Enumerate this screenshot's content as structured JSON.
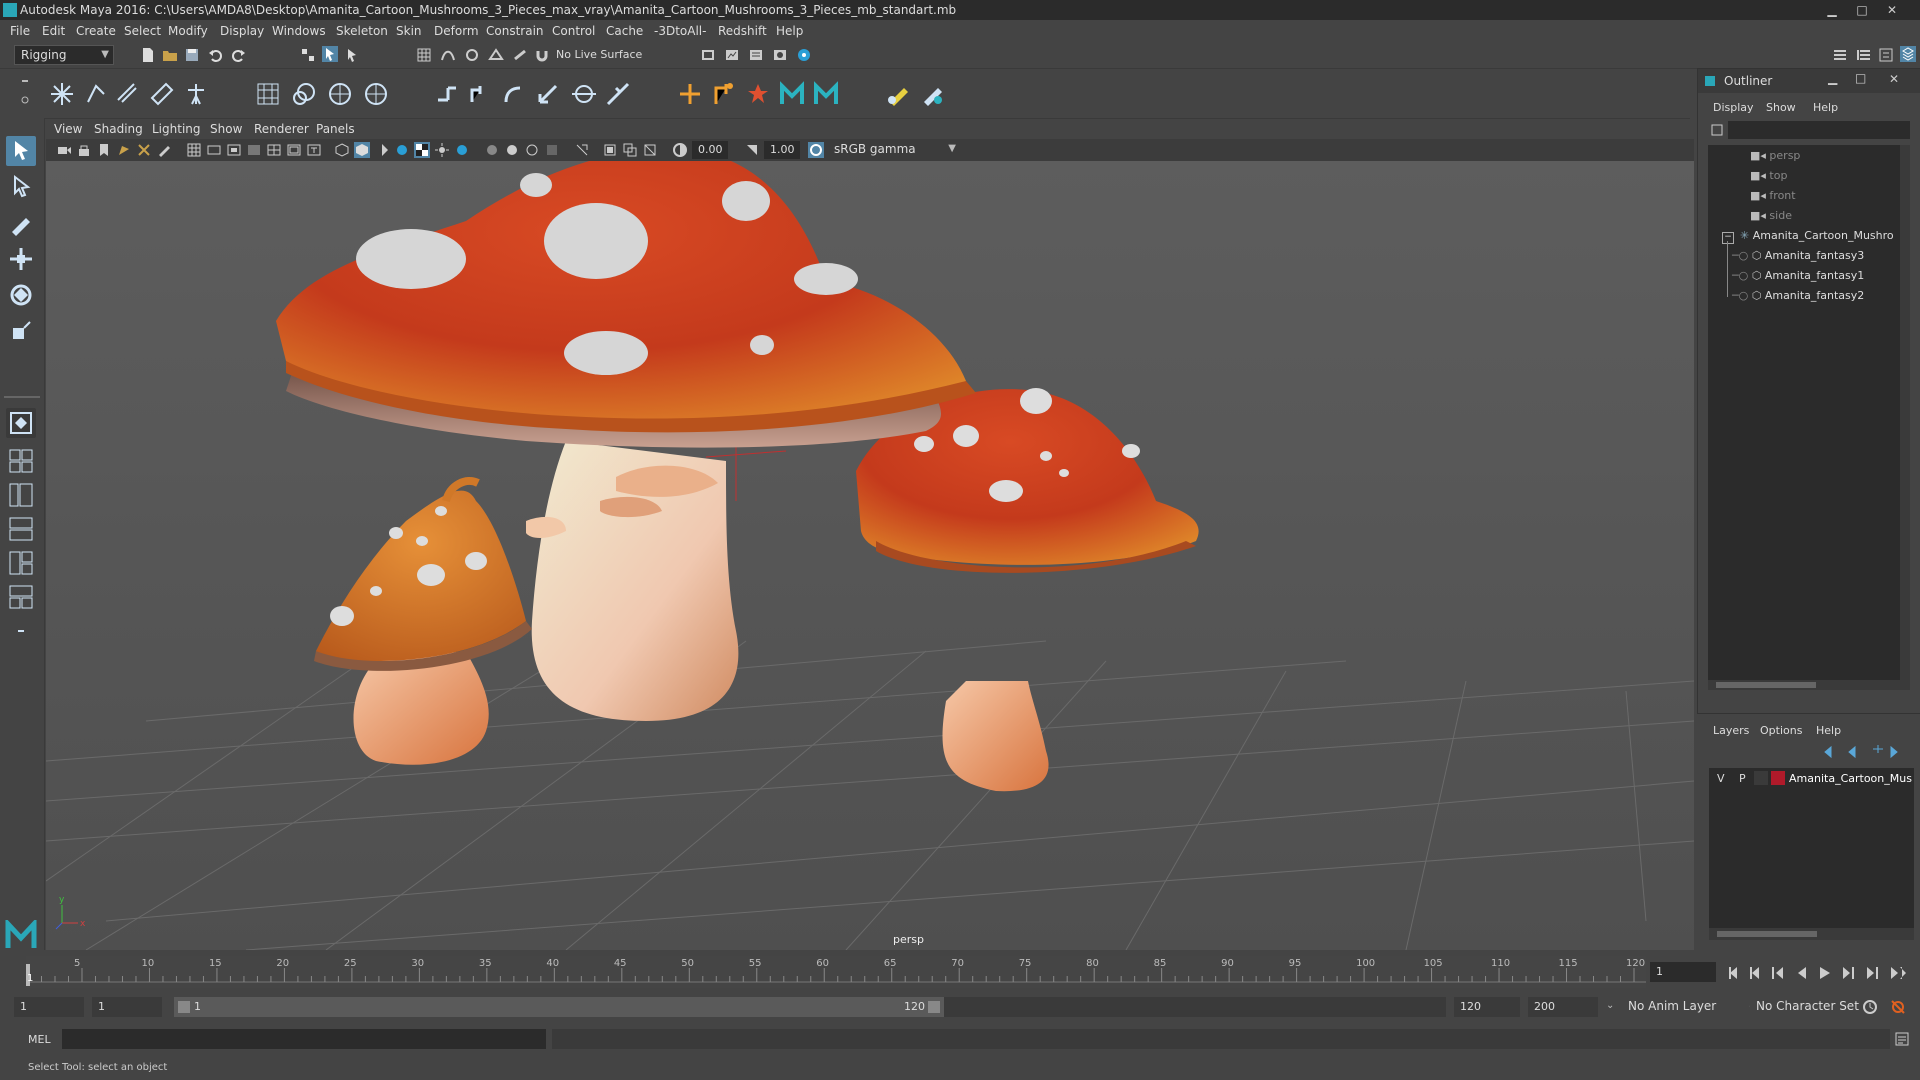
{
  "window": {
    "title": "Autodesk Maya 2016: C:\\Users\\AMDA8\\Desktop\\Amanita_Cartoon_Mushrooms_3_Pieces_max_vray\\Amanita_Cartoon_Mushrooms_3_Pieces_mb_standart.mb",
    "minimize": "▁",
    "maximize": "□",
    "close": "✕"
  },
  "menubar": [
    "File",
    "Edit",
    "Create",
    "Select",
    "Modify",
    "Display",
    "Windows",
    "Skeleton",
    "Skin",
    "Deform",
    "Constrain",
    "Control",
    "Cache",
    "-3DtoAll-",
    "Redshift",
    "Help"
  ],
  "statusline": {
    "menuset": "Rigging",
    "live_surface": "No Live Surface"
  },
  "panel_menu": [
    "View",
    "Shading",
    "Lighting",
    "Show",
    "Renderer",
    "Panels"
  ],
  "viewport_toolbar": {
    "exposure": "0.00",
    "gamma": "1.00",
    "color_space": "sRGB gamma"
  },
  "viewport": {
    "camera_label": "persp",
    "axis_y": "y",
    "axis_x": "x"
  },
  "outliner": {
    "title": "Outliner",
    "menus": [
      "Display",
      "Show",
      "Help"
    ],
    "items": [
      {
        "label": "persp",
        "type": "camera"
      },
      {
        "label": "top",
        "type": "camera"
      },
      {
        "label": "front",
        "type": "camera"
      },
      {
        "label": "side",
        "type": "camera"
      },
      {
        "label": "Amanita_Cartoon_Mushro",
        "type": "group"
      },
      {
        "label": "Amanita_fantasy3",
        "type": "mesh"
      },
      {
        "label": "Amanita_fantasy1",
        "type": "mesh"
      },
      {
        "label": "Amanita_fantasy2",
        "type": "mesh"
      }
    ]
  },
  "layers": {
    "menus": [
      "Layers",
      "Options",
      "Help"
    ],
    "row": {
      "v": "V",
      "p": "P",
      "name": "Amanita_Cartoon_Mus",
      "color": "#b01a2a"
    }
  },
  "timeline": {
    "ticks": [
      "5",
      "10",
      "15",
      "20",
      "25",
      "30",
      "35",
      "40",
      "45",
      "50",
      "55",
      "60",
      "65",
      "70",
      "75",
      "80",
      "85",
      "90",
      "95",
      "100",
      "105",
      "110",
      "115",
      "120"
    ],
    "current_frame_marker": "1",
    "current_frame": "1"
  },
  "range": {
    "start": "1",
    "playback_start": "1",
    "slider_start": "1",
    "slider_end": "120",
    "playback_end": "120",
    "end": "200",
    "anim_layer": "No Anim Layer",
    "character_set": "No Character Set"
  },
  "cmdline": {
    "label": "MEL"
  },
  "helpline": {
    "text": "Select Tool: select an object"
  }
}
